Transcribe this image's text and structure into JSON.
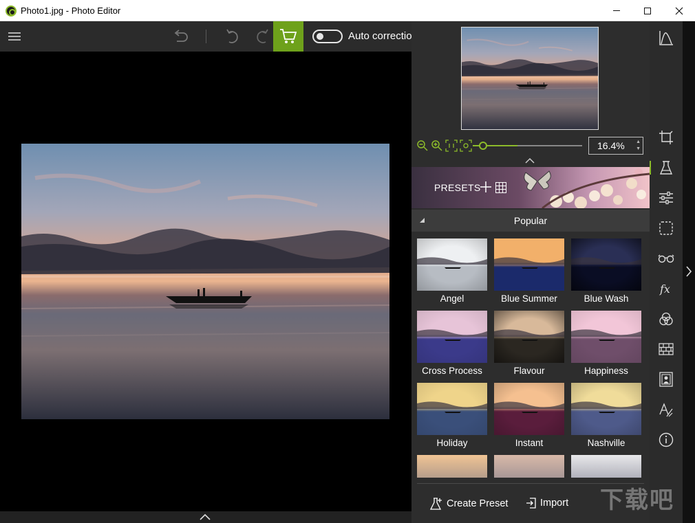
{
  "window": {
    "title": "Photo1.jpg - Photo Editor"
  },
  "toolbar": {
    "auto_correction_label": "Auto correction",
    "auto_correction_on": false
  },
  "zoom": {
    "value": "16.4%",
    "slider_fraction": 0.4
  },
  "presets": {
    "header_label": "PRESETS",
    "section_title": "Popular",
    "items": [
      {
        "label": "Angel"
      },
      {
        "label": "Blue Summer"
      },
      {
        "label": "Blue Wash"
      },
      {
        "label": "Cross Process"
      },
      {
        "label": "Flavour"
      },
      {
        "label": "Happiness"
      },
      {
        "label": "Holiday"
      },
      {
        "label": "Instant"
      },
      {
        "label": "Nashville"
      }
    ]
  },
  "footer": {
    "create_preset_label": "Create Preset",
    "import_label": "Import"
  },
  "sidebar": {
    "items": [
      "histogram-icon",
      "crop-icon",
      "flask-icon",
      "sliders-icon",
      "selection-icon",
      "glasses-icon",
      "fx-icon",
      "color-circles-icon",
      "texture-icon",
      "frame-icon",
      "text-icon",
      "info-icon"
    ]
  },
  "watermark": {
    "text": "下载吧"
  },
  "colors": {
    "accent": "#8dbb2a",
    "cart_bg": "#6ea11b",
    "panel_bg": "#2d2d2d",
    "toolbar_bg": "#2b2b2b"
  }
}
